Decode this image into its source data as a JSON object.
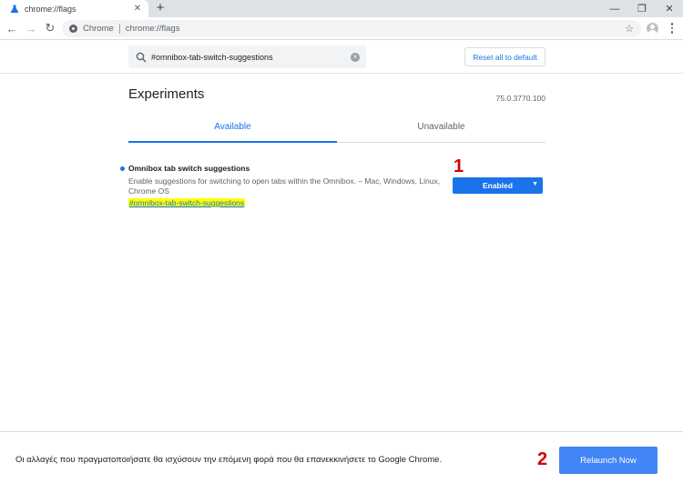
{
  "browser": {
    "tab_title": "chrome://flags",
    "tab_close_glyph": "✕",
    "new_tab_glyph": "+",
    "window_controls": {
      "minimize": "—",
      "restore": "❐",
      "close": "✕"
    },
    "nav": {
      "back": "←",
      "forward": "→",
      "reload": "↻"
    },
    "omnibox": {
      "chip": "Chrome",
      "url": "chrome://flags",
      "star": "☆"
    }
  },
  "flags": {
    "search_query": "#omnibox-tab-switch-suggestions",
    "reset_label": "Reset all to default",
    "title": "Experiments",
    "version": "75.0.3770.100",
    "tabs": {
      "available": "Available",
      "unavailable": "Unavailable"
    },
    "experiment": {
      "name": "Omnibox tab switch suggestions",
      "description": "Enable suggestions for switching to open tabs within the Omnibox. – Mac, Windows, Linux, Chrome OS",
      "link": "#omnibox-tab-switch-suggestions",
      "state": "Enabled",
      "arrow": "▼"
    }
  },
  "annotations": {
    "marker_1": "1",
    "marker_2": "2",
    "marker_color": "#d50000"
  },
  "relaunch": {
    "message": "Οι αλλαγές που πραγματοποιήσατε θα ισχύσουν την επόμενη φορά που θα επανεκκινήσετε το Google Chrome.",
    "button": "Relaunch Now"
  },
  "colors": {
    "accent": "#1a73e8",
    "relaunch_button": "#4285f4",
    "highlight": "#ffff00"
  }
}
